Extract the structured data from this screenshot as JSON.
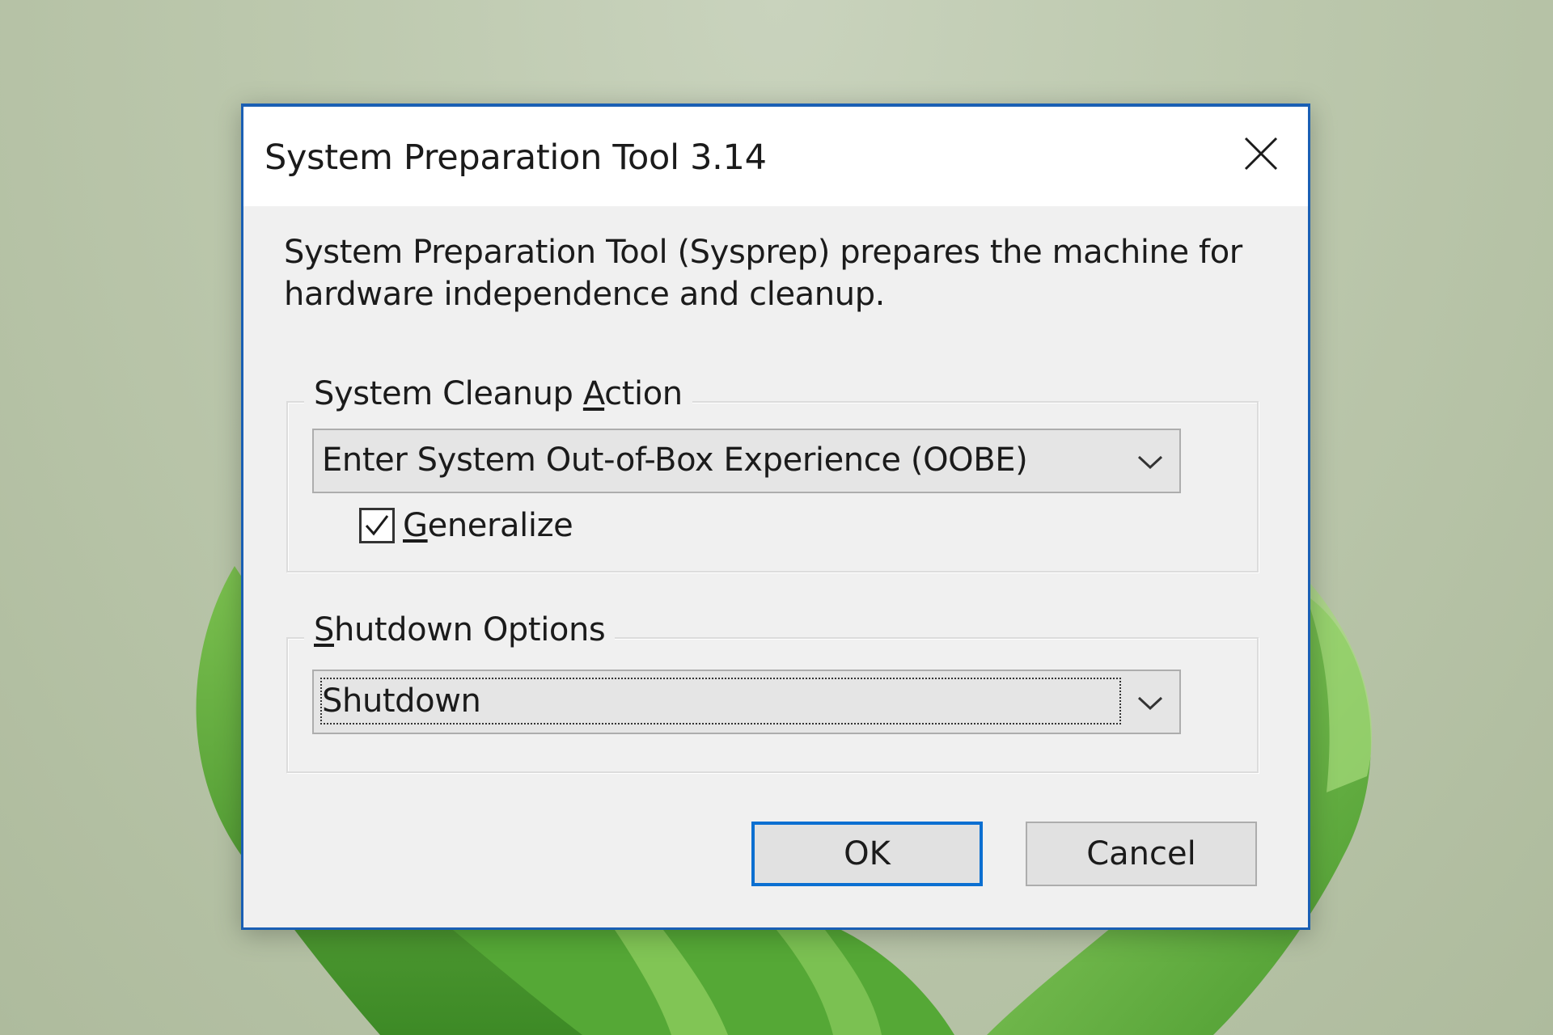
{
  "dialog": {
    "title": "System Preparation Tool 3.14",
    "description": "System Preparation Tool (Sysprep) prepares the machine for hardware independence and cleanup.",
    "close_icon": "close-icon"
  },
  "cleanup_group": {
    "label_before": "System Cleanup ",
    "label_accel": "A",
    "label_after": "ction",
    "selected_value": "Enter System Out-of-Box Experience (OOBE)",
    "generalize": {
      "label_accel": "G",
      "label_rest": "eneralize",
      "checked": true
    }
  },
  "shutdown_group": {
    "label_accel": "S",
    "label_rest": "hutdown Options",
    "selected_value": "Shutdown"
  },
  "buttons": {
    "ok_label": "OK",
    "cancel_label": "Cancel"
  },
  "colors": {
    "dialog_border": "#1a5fb4",
    "focus_border": "#0b6fd1",
    "wallpaper_green": "#5aa33a"
  }
}
